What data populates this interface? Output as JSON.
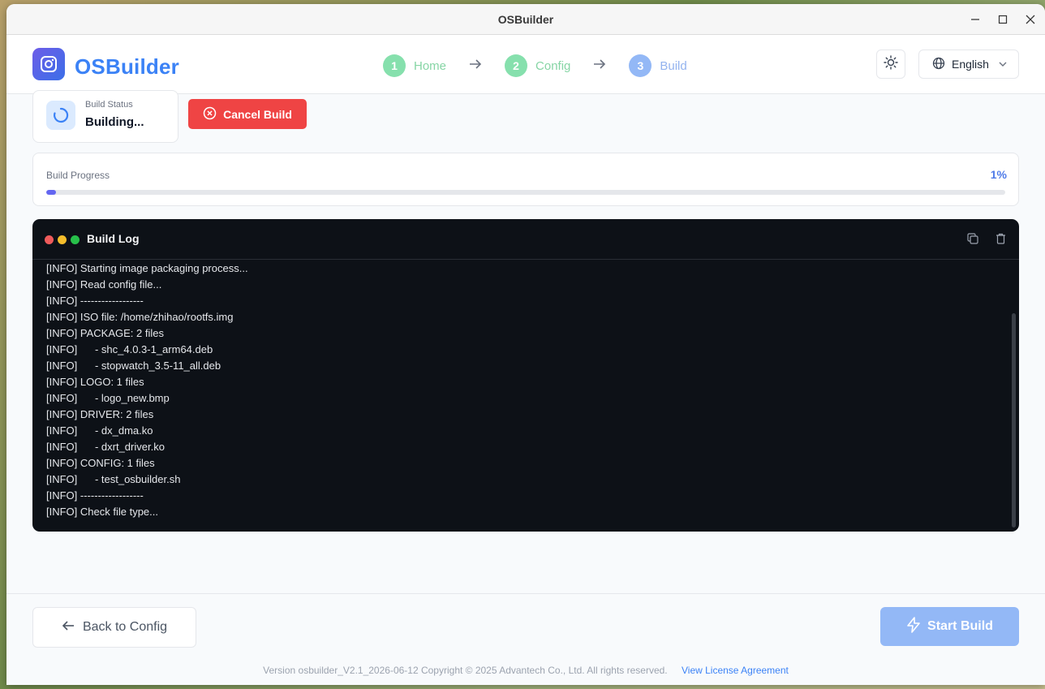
{
  "window": {
    "title": "OSBuilder"
  },
  "header": {
    "app_name": "OSBuilder",
    "steps": [
      {
        "num": "1",
        "label": "Home",
        "state": "done"
      },
      {
        "num": "2",
        "label": "Config",
        "state": "done"
      },
      {
        "num": "3",
        "label": "Build",
        "state": "active"
      }
    ],
    "language": "English"
  },
  "status": {
    "label": "Build Status",
    "value": "Building..."
  },
  "cancel_label": "Cancel Build",
  "progress": {
    "label": "Build Progress",
    "percent_text": "1%",
    "value": 0.01
  },
  "log": {
    "title": "Build Log",
    "lines": [
      "[INFO] Starting image packaging process...",
      "[INFO] Read config file...",
      "[INFO] ------------------",
      "[INFO] ISO file: /home/zhihao/rootfs.img",
      "[INFO] PACKAGE: 2 files",
      "[INFO]      - shc_4.0.3-1_arm64.deb",
      "[INFO]      - stopwatch_3.5-11_all.deb",
      "[INFO] LOGO: 1 files",
      "[INFO]      - logo_new.bmp",
      "[INFO] DRIVER: 2 files",
      "[INFO]      - dx_dma.ko",
      "[INFO]      - dxrt_driver.ko",
      "[INFO] CONFIG: 1 files",
      "[INFO]      - test_osbuilder.sh",
      "[INFO] ------------------",
      "[INFO] Check file type..."
    ]
  },
  "footer": {
    "back_label": "Back to Config",
    "start_label": "Start Build",
    "version_text": "Version osbuilder_V2.1_2026-06-12 Copyright © 2025 Advantech Co., Ltd. All rights reserved.",
    "license_link": "View License Agreement"
  },
  "colors": {
    "accent": "#3b82f6",
    "danger": "#ef4444",
    "success": "#86e0ad",
    "progress": "#6366f1"
  },
  "icons": [
    "minimize-icon",
    "maximize-icon",
    "close-icon",
    "camera-logo-icon",
    "arrow-right-icon",
    "sun-icon",
    "globe-icon",
    "chevron-down-icon",
    "spinner-icon",
    "x-circle-icon",
    "copy-icon",
    "trash-icon",
    "arrow-left-icon",
    "lightning-icon"
  ]
}
